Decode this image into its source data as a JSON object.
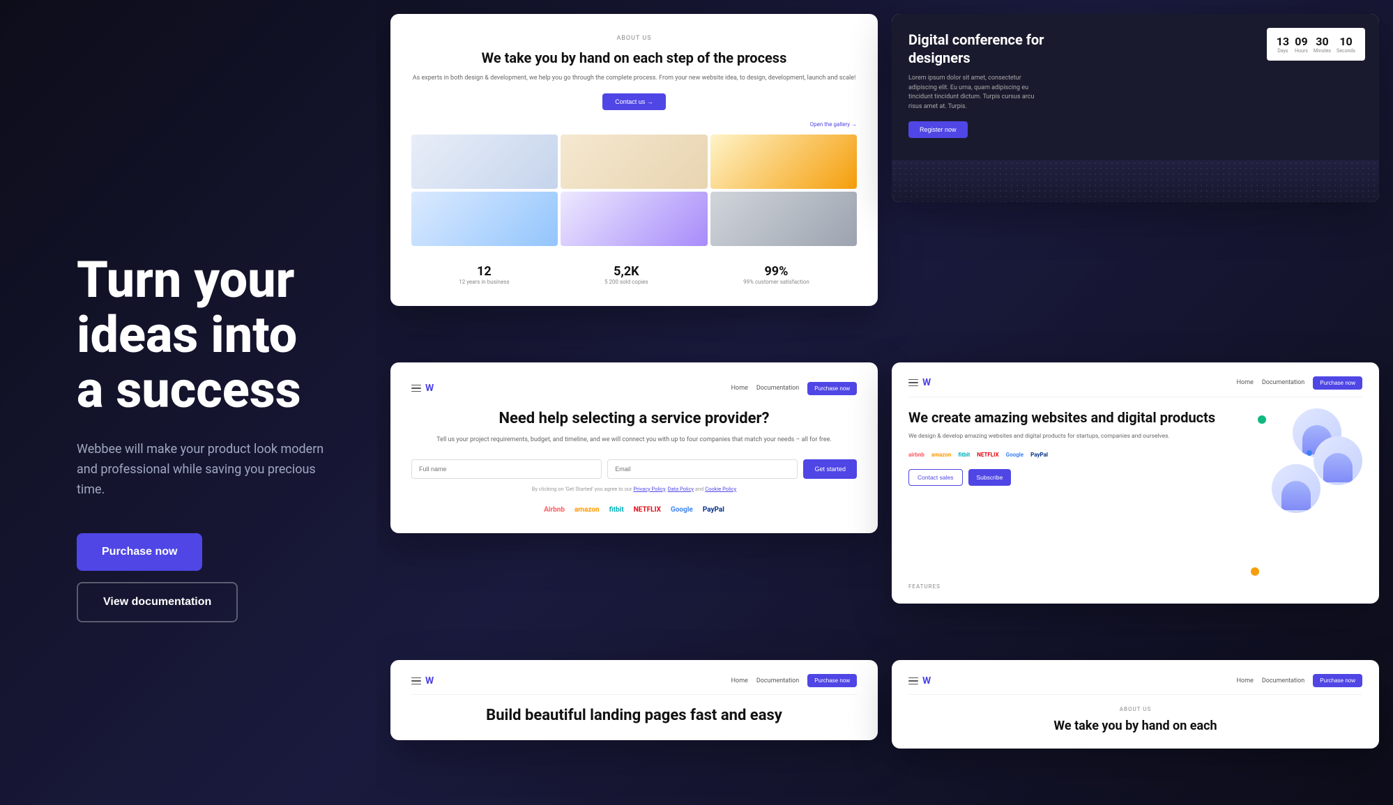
{
  "hero": {
    "title": "Turn your ideas into a success",
    "subtitle": "Webbee will make your product look modern and professional while saving you precious time.",
    "purchase_btn": "Purchase now",
    "docs_btn": "View documentation"
  },
  "card1": {
    "about_label": "ABOUT US",
    "title": "We take you by hand on each step of the process",
    "description": "As experts in both design & development, we help you go through the complete process. From your new website idea, to design, development, launch and scale!",
    "contact_btn": "Contact us →",
    "open_gallery": "Open the gallery →",
    "stats": [
      {
        "number": "12",
        "label": "12 years in business"
      },
      {
        "number": "5,2K",
        "label": "5 200 sold copies"
      },
      {
        "number": "99%",
        "label": "99% customer satisfaction"
      }
    ]
  },
  "card2": {
    "title": "Digital conference for designers",
    "description": "Lorem ipsum dolor sit amet, consectetur adipiscing elit. Eu urna, quam adipiscing eu tincidunt tincidunt dictum. Turpis cursus arcu risus amet at. Turpis.",
    "register_btn": "Register now",
    "countdown": [
      {
        "number": "13",
        "label": "Days"
      },
      {
        "number": "09",
        "label": "Hours"
      },
      {
        "number": "30",
        "label": "Minutes"
      },
      {
        "number": "10",
        "label": "Seconds"
      }
    ]
  },
  "card3": {
    "nav": {
      "home": "Home",
      "docs": "Documentation",
      "purchase": "Purchase now"
    },
    "title": "Need help selecting a service provider?",
    "subtitle": "Tell us your project requirements, budget, and timeline, and we will connect you with up to four companies that match your needs – all for free.",
    "form": {
      "full_name_placeholder": "Full name",
      "email_placeholder": "Email",
      "submit_btn": "Get started"
    },
    "terms": "By clicking on 'Get Started' you agree to our Privacy Policy, Data Policy and Cookie Policy",
    "brands": [
      "Airbnb",
      "amazon",
      "fitbit",
      "NETFLIX",
      "Google",
      "PayPal"
    ]
  },
  "card4": {
    "nav": {
      "home": "Home",
      "docs": "Documentation",
      "purchase": "Purchase now"
    },
    "title": "We create amazing websites and digital products",
    "description": "We design & develop amazing websites and digital products for startups, companies and ourselves.",
    "brands": [
      "airbnb",
      "amazon",
      "fitbit",
      "NETFLIX",
      "Google",
      "PayPal"
    ],
    "contact_btn": "Contact sales",
    "subscribe_btn": "Subscribe",
    "features_label": "FEATURES"
  },
  "card5": {
    "nav": {
      "home": "Home",
      "docs": "Documentation",
      "purchase": "Purchase now"
    },
    "title": "Build beautiful landing pages fast and easy"
  },
  "card6": {
    "nav": {
      "home": "Home",
      "docs": "Documentation",
      "purchase": "Purchase now"
    },
    "about_label": "ABOUT US",
    "title": "We take you by hand on each"
  }
}
